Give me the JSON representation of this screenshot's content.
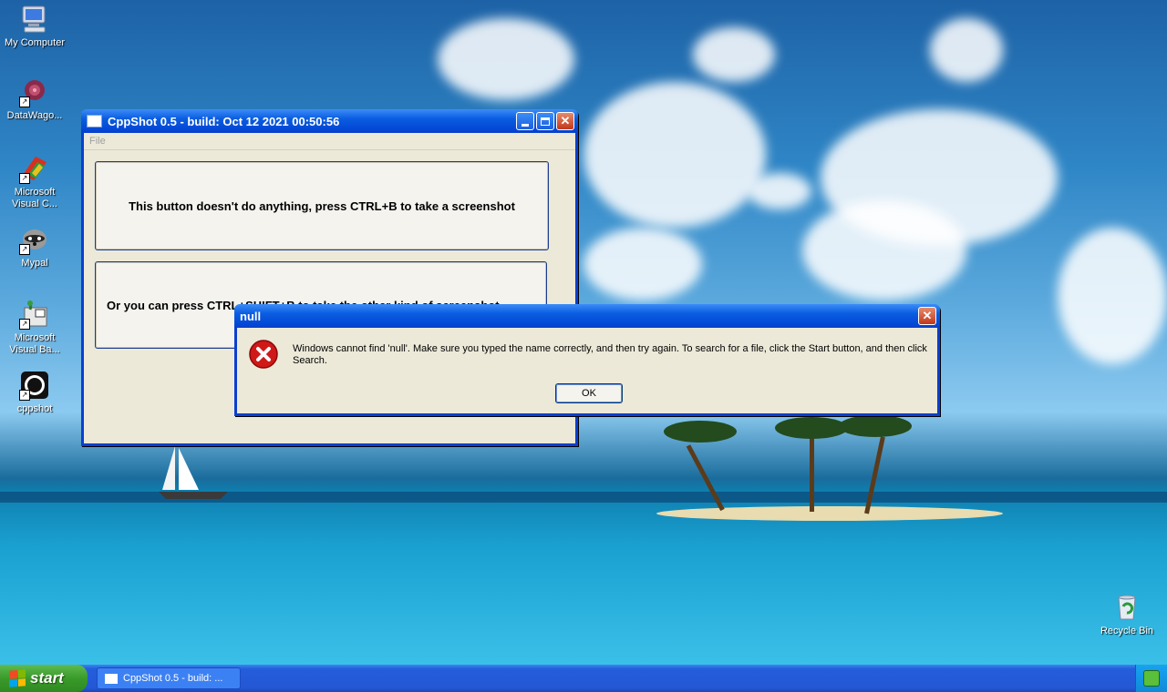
{
  "desktop": {
    "icons": [
      {
        "label": "My Computer",
        "icon": "computer-icon"
      },
      {
        "label": "DataWago...",
        "icon": "datawagon-icon"
      },
      {
        "label": "Microsoft Visual C...",
        "icon": "visual-c-icon"
      },
      {
        "label": "Mypal",
        "icon": "raccoon-icon"
      },
      {
        "label": "Microsoft Visual Ba...",
        "icon": "visual-basic-icon"
      },
      {
        "label": "cppshot",
        "icon": "cppshot-icon"
      },
      {
        "label": "Recycle Bin",
        "icon": "recycle-bin-icon"
      }
    ]
  },
  "app_window": {
    "title": "CppShot 0.5 - build: Oct 12 2021 00:50:56",
    "menu": {
      "file": "File"
    },
    "button1": "This button doesn't do anything, press CTRL+B to take a screenshot",
    "button2": "Or you can press CTRL+SHIFT+B to take the other kind of screenshot"
  },
  "dialog": {
    "title": "null",
    "message": "Windows cannot find 'null'. Make sure you typed the name correctly, and then try again. To search for a file, click the Start button, and then click Search.",
    "ok": "OK",
    "icon": "error-icon"
  },
  "taskbar": {
    "start": "start",
    "task_item": "CppShot 0.5 - build: ..."
  },
  "colors": {
    "title_blue": "#0a5de0",
    "error_red": "#d01818",
    "start_green": "#3a9a2a"
  }
}
